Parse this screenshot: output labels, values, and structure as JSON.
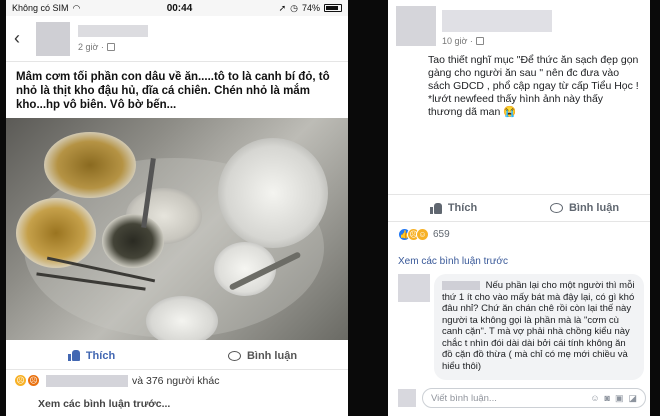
{
  "left_post": {
    "status": {
      "carrier": "Không có SIM",
      "time": "00:44",
      "battery": "74%"
    },
    "meta_time": "2 giờ ·",
    "text": "Mâm cơm tối phần con dâu về ăn.....tô to là canh bí đỏ, tô nhỏ là thịt kho đậu hủ, dĩa cá chiên. Chén nhỏ là mắm kho...hp vô biên. Vô bờ bến...",
    "like_label": "Thích",
    "comment_label": "Bình luận",
    "reactions_text": "và 376 người khác",
    "more_comments": "Xem các bình luận trước..."
  },
  "right_post": {
    "meta_time": "10 giờ ·",
    "text": "Tao thiết nghĩ mục \"Để thức ăn sạch đẹp gọn gàng cho người ăn sau \" nên đc đưa vào sách GDCD , phổ cập ngay từ cấp Tiểu Học ! *lướt newfeed thấy hình ảnh này thấy thương dã man 😭",
    "like_label": "Thích",
    "comment_label": "Bình luận",
    "reaction_count": "659",
    "more_comments": "Xem các bình luận trước",
    "comment_text": "Nếu phần lại cho một người thì mỗi thứ 1 ít cho vào mấy bát mà đậy lại, có gì khó đâu nhỉ? Chứ ăn chán chê rồi còn lại thế này người ta không gọi là phần mà là \"cơm cù canh cặn\". T mà vợ phải nhà chồng kiểu này chắc t nhìn đói dài dài bởi cái tính không ăn đồ cặn đồ thừa ( mà chỉ có mẹ mới chiều và hiểu thôi)",
    "write_placeholder": "Viết bình luận..."
  },
  "colors": {
    "accent": "#4267b2",
    "link": "#385898"
  }
}
